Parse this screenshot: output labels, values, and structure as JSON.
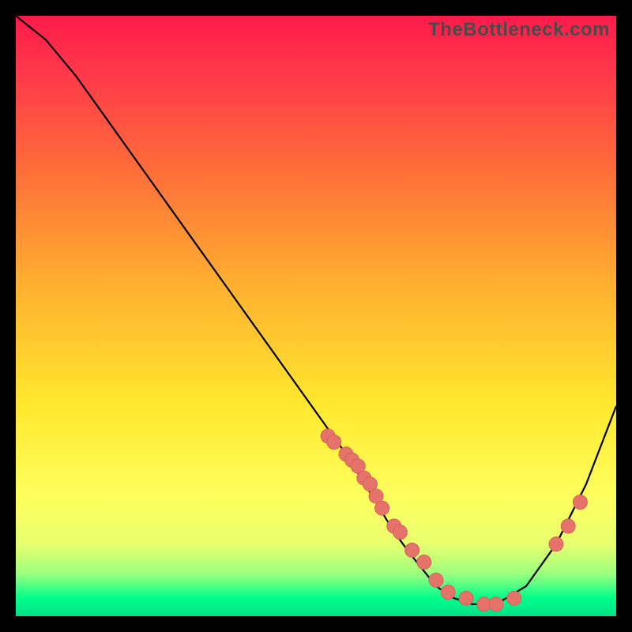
{
  "watermark": "TheBottleneck.com",
  "chart_data": {
    "type": "line",
    "title": "",
    "xlabel": "",
    "ylabel": "",
    "xlim": [
      0,
      100
    ],
    "ylim": [
      0,
      100
    ],
    "series": [
      {
        "name": "curve",
        "x": [
          0,
          5,
          10,
          15,
          20,
          25,
          30,
          35,
          40,
          45,
          50,
          55,
          60,
          63,
          66,
          70,
          73,
          76,
          80,
          85,
          90,
          95,
          100
        ],
        "y": [
          100,
          96,
          90,
          83,
          76,
          69,
          62,
          55,
          48,
          41,
          34,
          27,
          19,
          14,
          10,
          5,
          3,
          2,
          2,
          5,
          12,
          22,
          35
        ]
      }
    ],
    "scatter_points": {
      "name": "dots",
      "x": [
        52,
        53,
        55,
        56,
        57,
        58,
        59,
        60,
        61,
        63,
        64,
        66,
        68,
        70,
        72,
        75,
        78,
        80,
        83,
        90,
        92,
        94
      ],
      "y": [
        30,
        29,
        27,
        26,
        25,
        23,
        22,
        20,
        18,
        15,
        14,
        11,
        9,
        6,
        4,
        3,
        2,
        2,
        3,
        12,
        15,
        19
      ]
    },
    "background_gradient": {
      "stops": [
        {
          "pos": 0,
          "color": "#ff1a4a"
        },
        {
          "pos": 10,
          "color": "#ff3a4a"
        },
        {
          "pos": 25,
          "color": "#ff6b3a"
        },
        {
          "pos": 45,
          "color": "#ffb030"
        },
        {
          "pos": 65,
          "color": "#ffe82e"
        },
        {
          "pos": 80,
          "color": "#ffff5e"
        },
        {
          "pos": 88,
          "color": "#e8ff6e"
        },
        {
          "pos": 93,
          "color": "#9aff7e"
        },
        {
          "pos": 97,
          "color": "#00ff8a"
        },
        {
          "pos": 100,
          "color": "#00e088"
        }
      ]
    }
  }
}
